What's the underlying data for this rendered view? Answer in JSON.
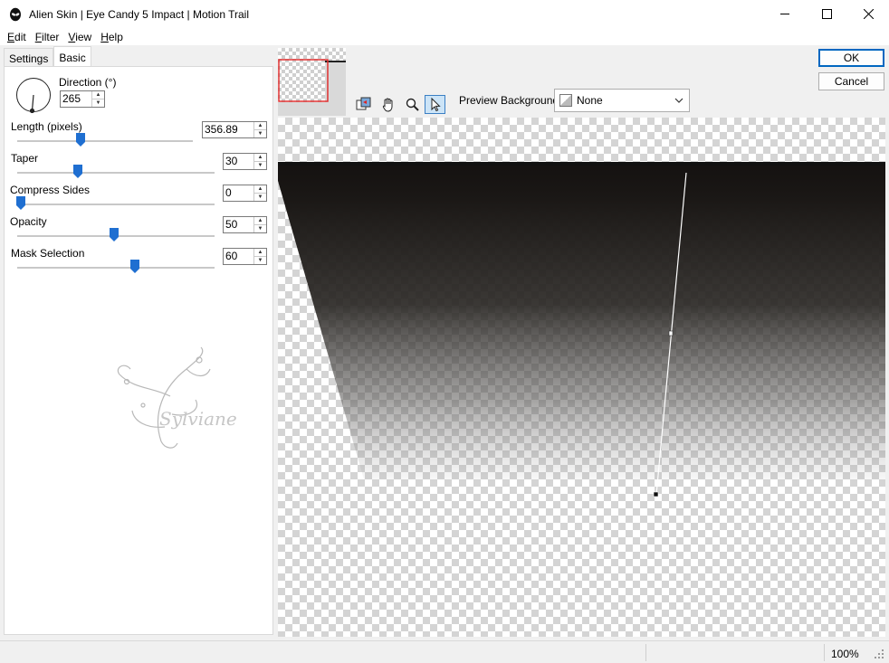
{
  "window": {
    "title": "Alien Skin | Eye Candy 5 Impact | Motion Trail"
  },
  "menu": {
    "items": [
      {
        "label": "Edit",
        "key": "E",
        "rest": "dit"
      },
      {
        "label": "Filter",
        "key": "F",
        "rest": "ilter"
      },
      {
        "label": "View",
        "key": "V",
        "rest": "iew"
      },
      {
        "label": "Help",
        "key": "H",
        "rest": "elp"
      }
    ]
  },
  "tabs": {
    "settings": "Settings",
    "basic": "Basic"
  },
  "controls": {
    "direction": {
      "label": "Direction (°)",
      "value": "265"
    },
    "length": {
      "label": "Length (pixels)",
      "value": "356.89",
      "fraction": 0.39
    },
    "taper": {
      "label": "Taper",
      "value": "30",
      "fraction": 0.3
    },
    "compress": {
      "label": "Compress Sides",
      "value": "0",
      "fraction": 0.0
    },
    "opacity": {
      "label": "Opacity",
      "value": "50",
      "fraction": 0.5
    },
    "mask": {
      "label": "Mask Selection",
      "value": "60",
      "fraction": 0.6
    }
  },
  "watermark": "Sylviane",
  "preview": {
    "background_label": "Preview Background:",
    "background_value": "None"
  },
  "buttons": {
    "ok": "OK",
    "cancel": "Cancel"
  },
  "status": {
    "zoom": "100%"
  },
  "colors": {
    "accent": "#0067c0",
    "slider_thumb": "#1f6fd1",
    "nav_frame": "#e03030"
  },
  "icons": [
    "alien-skin-app-icon",
    "minimize-icon",
    "maximize-icon",
    "close-icon",
    "preview-toggle-icon",
    "hand-icon",
    "zoom-icon",
    "arrow-pointer-icon",
    "chevron-down-icon",
    "resize-grip-icon"
  ]
}
